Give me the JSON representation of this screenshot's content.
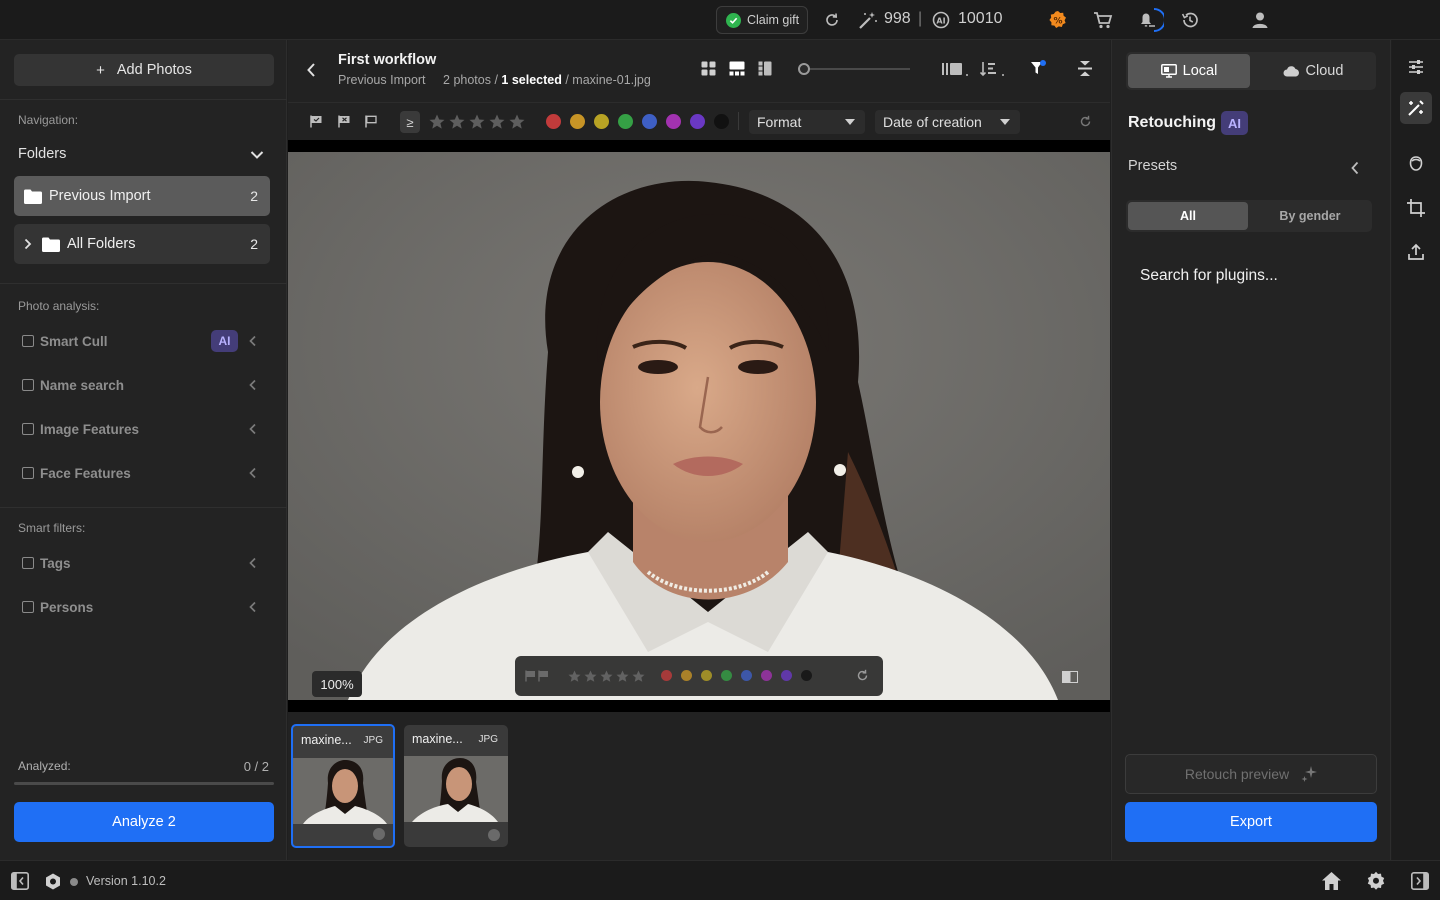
{
  "topbar": {
    "claim_gift": "Claim gift",
    "credits_magic": "998",
    "separator": "|",
    "credits_ai": "10010"
  },
  "left": {
    "add_photos": "Add Photos",
    "navigation_label": "Navigation:",
    "folders_label": "Folders",
    "folder_items": [
      {
        "label": "Previous Import",
        "count": "2"
      },
      {
        "label": "All Folders",
        "count": "2"
      }
    ],
    "photo_analysis_label": "Photo analysis:",
    "analysis_filters": [
      "Smart Cull",
      "Name search",
      "Image Features",
      "Face Features"
    ],
    "ai_badge": "AI",
    "smart_filters_label": "Smart filters:",
    "smart_filters": [
      "Tags",
      "Persons"
    ],
    "analyzed_label": "Analyzed:",
    "analyzed_value": "0 / 2",
    "analyze_button": "Analyze 2"
  },
  "center": {
    "workflow_title": "First workflow",
    "source": "Previous Import",
    "photo_count": "2 photos /",
    "selected_count": "1 selected",
    "filename": "/ maxine-01.jpg",
    "rating_operator": "≥",
    "color_labels": [
      "#c23b3b",
      "#c79426",
      "#b8a324",
      "#35a045",
      "#3e5fc4",
      "#a232b0",
      "#6a38c4",
      "#111111"
    ],
    "format_dropdown": "Format",
    "sort_dropdown": "Date of creation",
    "zoom_level": "100%",
    "thumbnails": [
      {
        "name": "maxine...",
        "type": "JPG",
        "selected": true
      },
      {
        "name": "maxine...",
        "type": "JPG",
        "selected": false
      }
    ]
  },
  "right": {
    "mode_local": "Local",
    "mode_cloud": "Cloud",
    "section_title": "Retouching",
    "ai_badge": "AI",
    "presets_label": "Presets",
    "filter_all": "All",
    "filter_gender": "By gender",
    "search_plugins": "Search for plugins...",
    "retouch_preview": "Retouch preview",
    "export_button": "Export"
  },
  "status": {
    "version": "Version 1.10.2"
  },
  "colors": {
    "accent_blue": "#1f6ff5",
    "ai_purple": "#443d78",
    "success_green": "#2fb44f",
    "promo_orange": "#f28a1e"
  }
}
